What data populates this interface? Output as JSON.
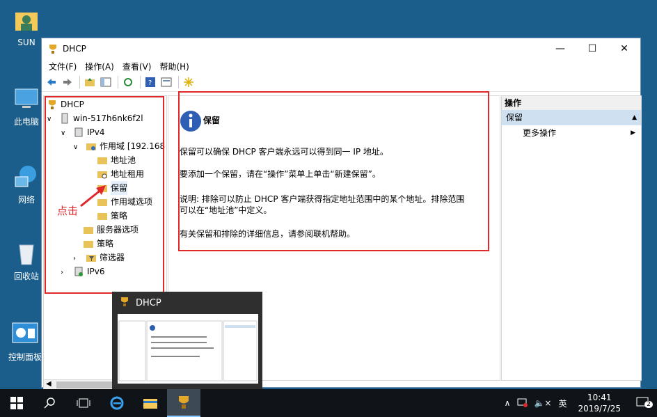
{
  "desktop": {
    "icons": [
      {
        "label": "SUN"
      },
      {
        "label": "此电脑"
      },
      {
        "label": "网络"
      },
      {
        "label": "回收站"
      },
      {
        "label": "控制面板"
      }
    ]
  },
  "window": {
    "title": "DHCP",
    "menu": [
      "文件(F)",
      "操作(A)",
      "查看(V)",
      "帮助(H)"
    ],
    "tree": {
      "root": "DHCP",
      "server": "win-517h6nk6f2l",
      "ipv4": "IPv4",
      "scope": "作用域 [192.168",
      "address_pool": "地址池",
      "address_leases": "地址租用",
      "reservations": "保留",
      "scope_options": "作用域选项",
      "scope_policies": "策略",
      "server_options": "服务器选项",
      "policies": "策略",
      "filters": "筛选器",
      "ipv6": "IPv6"
    },
    "content": {
      "heading": "保留",
      "p1": "保留可以确保 DHCP 客户端永远可以得到同一 IP 地址。",
      "p2": "要添加一个保留，请在“操作”菜单上单击“新建保留”。",
      "p3": "说明: 排除可以防止 DHCP 客户端获得指定地址范围中的某个地址。排除范围可以在“地址池”中定义。",
      "p4": "有关保留和排除的详细信息，请参阅联机帮助。"
    },
    "actions": {
      "header": "操作",
      "section": "保留",
      "more": "更多操作"
    }
  },
  "annotation": {
    "label": "点击"
  },
  "preview": {
    "title": "DHCP"
  },
  "tray": {
    "ime": "英",
    "time": "10:41",
    "date": "2019/7/25",
    "notifications": "2"
  }
}
